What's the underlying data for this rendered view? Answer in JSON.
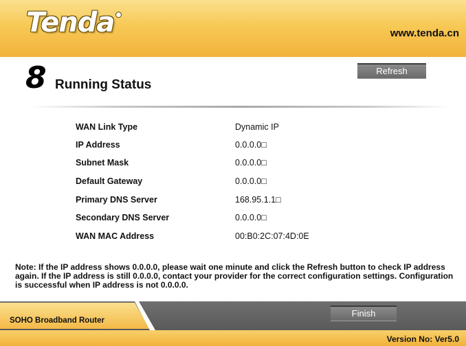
{
  "header": {
    "logo_text": "Tenda",
    "url": "www.tenda.cn"
  },
  "step": {
    "number": "8",
    "title": "Running Status"
  },
  "buttons": {
    "refresh": "Refresh",
    "finish": "Finish"
  },
  "status": [
    {
      "label": "WAN Link Type",
      "value": "Dynamic IP"
    },
    {
      "label": "IP Address",
      "value": "0.0.0.0□"
    },
    {
      "label": "Subnet Mask",
      "value": "0.0.0.0□"
    },
    {
      "label": "Default Gateway",
      "value": "0.0.0.0□"
    },
    {
      "label": "Primary DNS Server",
      "value": "168.95.1.1□"
    },
    {
      "label": "Secondary DNS Server",
      "value": "0.0.0.0□"
    },
    {
      "label": "WAN MAC Address",
      "value": "00:B0:2C:07:4D:0E"
    }
  ],
  "note": "Note: If the IP address shows 0.0.0.0, please wait one minute and click the Refresh button to check IP address again. If the IP address is still 0.0.0.0, contact your provider for the correct configuration settings. Configuration is successful when IP address is not 0.0.0.0.",
  "footer": {
    "product": "SOHO Broadband Router",
    "version": "Version No: Ver5.0"
  },
  "colors": {
    "brand_gold": "#f2b23b",
    "bar_gray": "#5a5a5a"
  }
}
